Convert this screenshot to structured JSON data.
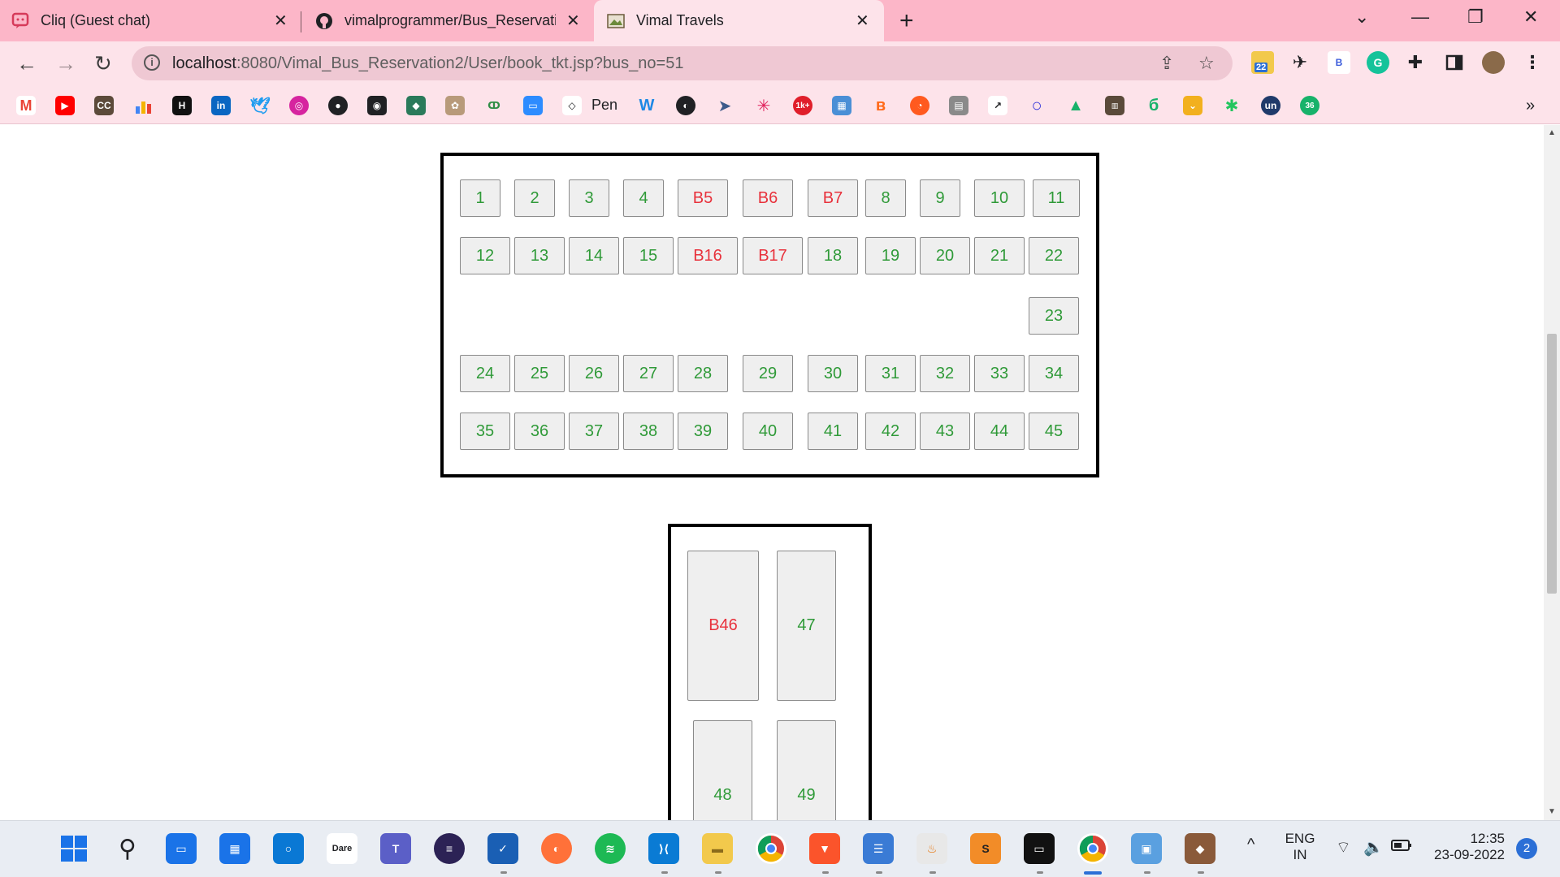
{
  "browser": {
    "tabs": [
      {
        "title": "Cliq (Guest chat)",
        "active": false,
        "icon": "chat-icon"
      },
      {
        "title": "vimalprogrammer/Bus_Reservatio",
        "active": false,
        "icon": "github-icon"
      },
      {
        "title": "Vimal Travels",
        "active": true,
        "icon": "page-icon"
      }
    ],
    "new_tab": "+",
    "url_host": "localhost",
    "url_rest": ":8080/Vimal_Bus_Reservation2/User/book_tkt.jsp?bus_no=51",
    "window_controls": {
      "minimize": "—",
      "restore": "❐",
      "close": "✕",
      "tab_search": "⌄"
    },
    "extension_badge": "22",
    "bookmarks": {
      "pen_label": "Pen",
      "overflow": "»",
      "badge_1k": "1k+",
      "badge_36": "36"
    }
  },
  "bus": {
    "upper_deck": {
      "row1": [
        {
          "label": "1",
          "booked": false
        },
        {
          "label": "2",
          "booked": false
        },
        {
          "label": "3",
          "booked": false
        },
        {
          "label": "4",
          "booked": false
        },
        {
          "label": "B5",
          "booked": true
        },
        {
          "label": "B6",
          "booked": true
        },
        {
          "label": "B7",
          "booked": true
        },
        {
          "label": "8",
          "booked": false
        },
        {
          "label": "9",
          "booked": false
        },
        {
          "label": "10",
          "booked": false
        },
        {
          "label": "11",
          "booked": false
        }
      ],
      "row2": [
        {
          "label": "12",
          "booked": false
        },
        {
          "label": "13",
          "booked": false
        },
        {
          "label": "14",
          "booked": false
        },
        {
          "label": "15",
          "booked": false
        },
        {
          "label": "B16",
          "booked": true
        },
        {
          "label": "B17",
          "booked": true
        },
        {
          "label": "18",
          "booked": false
        },
        {
          "label": "19",
          "booked": false
        },
        {
          "label": "20",
          "booked": false
        },
        {
          "label": "21",
          "booked": false
        },
        {
          "label": "22",
          "booked": false
        }
      ],
      "aisle": [
        {
          "label": "23",
          "booked": false
        }
      ],
      "row4": [
        {
          "label": "24",
          "booked": false
        },
        {
          "label": "25",
          "booked": false
        },
        {
          "label": "26",
          "booked": false
        },
        {
          "label": "27",
          "booked": false
        },
        {
          "label": "28",
          "booked": false
        },
        {
          "label": "29",
          "booked": false
        },
        {
          "label": "30",
          "booked": false
        },
        {
          "label": "31",
          "booked": false
        },
        {
          "label": "32",
          "booked": false
        },
        {
          "label": "33",
          "booked": false
        },
        {
          "label": "34",
          "booked": false
        }
      ],
      "row5": [
        {
          "label": "35",
          "booked": false
        },
        {
          "label": "36",
          "booked": false
        },
        {
          "label": "37",
          "booked": false
        },
        {
          "label": "38",
          "booked": false
        },
        {
          "label": "39",
          "booked": false
        },
        {
          "label": "40",
          "booked": false
        },
        {
          "label": "41",
          "booked": false
        },
        {
          "label": "42",
          "booked": false
        },
        {
          "label": "43",
          "booked": false
        },
        {
          "label": "44",
          "booked": false
        },
        {
          "label": "45",
          "booked": false
        }
      ]
    },
    "sleepers": [
      {
        "label": "B46",
        "booked": true
      },
      {
        "label": "47",
        "booked": false
      },
      {
        "label": "48",
        "booked": false
      },
      {
        "label": "49",
        "booked": false
      }
    ],
    "colors": {
      "booked": "#e8323c",
      "free": "#2f9a38",
      "seat_bg": "#efefef"
    }
  },
  "taskbar": {
    "lang_top": "ENG",
    "lang_bottom": "IN",
    "time": "12:35",
    "date": "23-09-2022",
    "notifications": "2",
    "dare_label": "Dare"
  }
}
